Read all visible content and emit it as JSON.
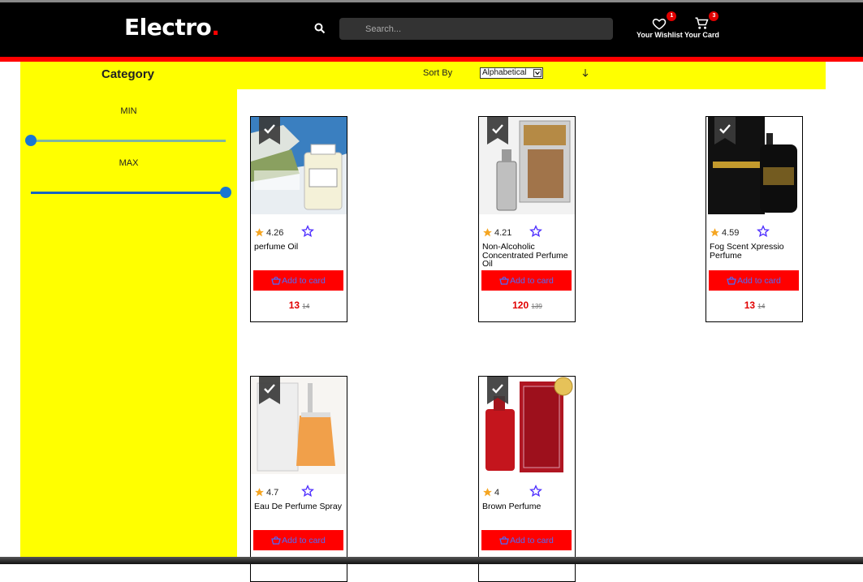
{
  "header": {
    "logo_text": "Electro",
    "logo_dot": ".",
    "search_placeholder": "Search...",
    "wishlist_label": "Your Wishlist",
    "wishlist_count": "1",
    "cart_label": "Your Card",
    "cart_count": "3"
  },
  "sidebar": {
    "title": "Category",
    "min_label": "MIN",
    "max_label": "MAX",
    "min_value_fraction": 0.0,
    "max_value_fraction": 1.0
  },
  "sort": {
    "label": "Sort By",
    "selected": "Alphabetical"
  },
  "products": [
    {
      "rating": "4.26",
      "name": "perfume Oil",
      "button": "Add to card",
      "price": "13",
      "old_price": "14",
      "image_icon": "perfume-bottle-marine"
    },
    {
      "rating": "4.21",
      "name": "Non-Alcoholic Concentrated Perfume Oil",
      "button": "Add to card",
      "price": "120",
      "old_price": "139",
      "image_icon": "perfume-oil-box"
    },
    {
      "rating": "4.59",
      "name": "Fog Scent Xpressio Perfume",
      "button": "Add to card",
      "price": "13",
      "old_price": "14",
      "image_icon": "fogg-perfume"
    },
    {
      "rating": "4.7",
      "name": "Eau De Perfume Spray",
      "button": "Add to card",
      "price": "",
      "old_price": "",
      "image_icon": "spray-bottle"
    },
    {
      "rating": "4",
      "name": "Brown Perfume",
      "button": "Add to card",
      "price": "",
      "old_price": "",
      "image_icon": "red-perfume-box"
    }
  ],
  "colors": {
    "accent": "#ff0000",
    "sidebar_bg": "#ffff00",
    "navbar_bg": "#000000",
    "star": "#f5a623",
    "wish_star": "#4b2bff"
  }
}
